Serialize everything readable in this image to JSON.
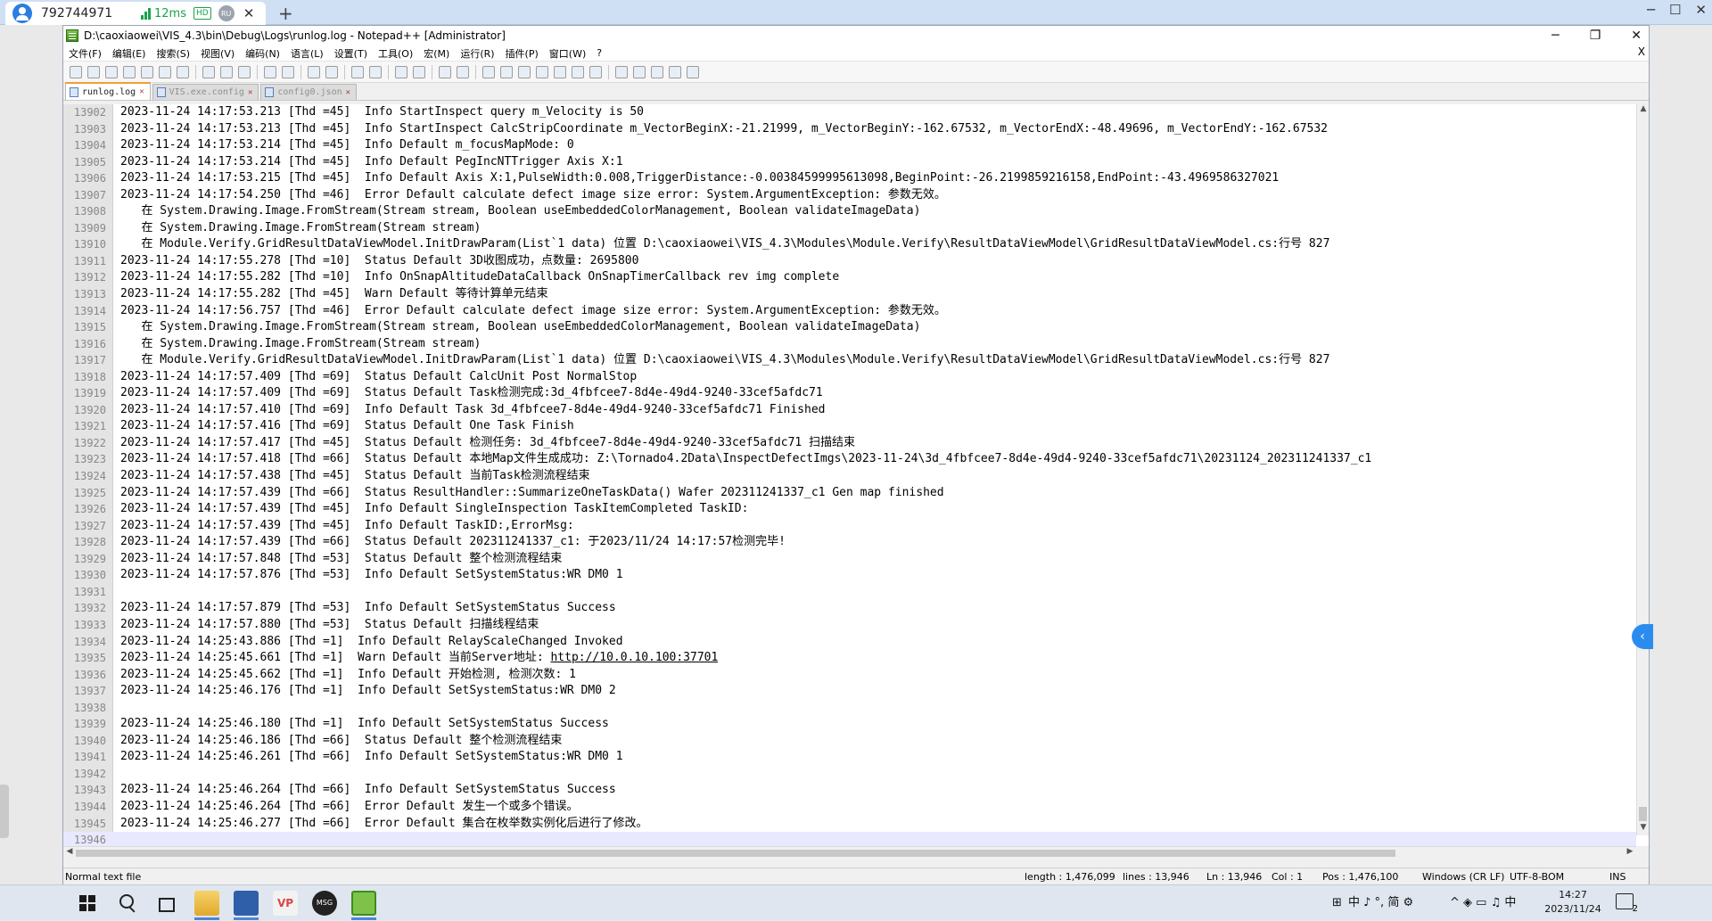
{
  "remote": {
    "session_id": "792744971",
    "ping": "12ms",
    "quality_badge": "HD",
    "region_badge": "RU",
    "close_glyph": "✕",
    "add_glyph": "+"
  },
  "window": {
    "title": "D:\\caoxiaowei\\VIS_4.3\\bin\\Debug\\Logs\\runlog.log - Notepad++ [Administrator]",
    "minimize": "─",
    "restore": "❐",
    "close": "✕"
  },
  "menu": [
    {
      "label": "文件(F)"
    },
    {
      "label": "编辑(E)"
    },
    {
      "label": "搜索(S)"
    },
    {
      "label": "视图(V)"
    },
    {
      "label": "编码(N)"
    },
    {
      "label": "语言(L)"
    },
    {
      "label": "设置(T)"
    },
    {
      "label": "工具(O)"
    },
    {
      "label": "宏(M)"
    },
    {
      "label": "运行(R)"
    },
    {
      "label": "插件(P)"
    },
    {
      "label": "窗口(W)"
    },
    {
      "label": "?"
    }
  ],
  "menu_close": "X",
  "tabs": [
    {
      "label": "runlog.log",
      "close": "✕"
    },
    {
      "label": "VIS.exe.config",
      "close": "✕"
    },
    {
      "label": "config0.json",
      "close": "✕"
    }
  ],
  "editor": {
    "lines": [
      {
        "n": "13902",
        "t": "2023-11-24 14:17:53.213 [Thd =45]  Info StartInspect query m_Velocity is 50"
      },
      {
        "n": "13903",
        "t": "2023-11-24 14:17:53.213 [Thd =45]  Info StartInspect CalcStripCoordinate m_VectorBeginX:-21.21999, m_VectorBeginY:-162.67532, m_VectorEndX:-48.49696, m_VectorEndY:-162.67532"
      },
      {
        "n": "13904",
        "t": "2023-11-24 14:17:53.214 [Thd =45]  Info Default m_focusMapMode: 0"
      },
      {
        "n": "13905",
        "t": "2023-11-24 14:17:53.214 [Thd =45]  Info Default PegIncNTTrigger Axis X:1"
      },
      {
        "n": "13906",
        "t": "2023-11-24 14:17:53.215 [Thd =45]  Info Default Axis X:1,PulseWidth:0.008,TriggerDistance:-0.00384599995613098,BeginPoint:-26.2199859216158,EndPoint:-43.4969586327021"
      },
      {
        "n": "13907",
        "t": "2023-11-24 14:17:54.250 [Thd =46]  Error Default calculate defect image size error: System.ArgumentException: 参数无效。"
      },
      {
        "n": "13908",
        "t": "   在 System.Drawing.Image.FromStream(Stream stream, Boolean useEmbeddedColorManagement, Boolean validateImageData)"
      },
      {
        "n": "13909",
        "t": "   在 System.Drawing.Image.FromStream(Stream stream)"
      },
      {
        "n": "13910",
        "t": "   在 Module.Verify.GridResultDataViewModel.InitDrawParam(List`1 data) 位置 D:\\caoxiaowei\\VIS_4.3\\Modules\\Module.Verify\\ResultDataViewModel\\GridResultDataViewModel.cs:行号 827"
      },
      {
        "n": "13911",
        "t": "2023-11-24 14:17:55.278 [Thd =10]  Status Default 3D收图成功，点数量: 2695800"
      },
      {
        "n": "13912",
        "t": "2023-11-24 14:17:55.282 [Thd =10]  Info OnSnapAltitudeDataCallback OnSnapTimerCallback rev img complete"
      },
      {
        "n": "13913",
        "t": "2023-11-24 14:17:55.282 [Thd =45]  Warn Default 等待计算单元结束"
      },
      {
        "n": "13914",
        "t": "2023-11-24 14:17:56.757 [Thd =46]  Error Default calculate defect image size error: System.ArgumentException: 参数无效。"
      },
      {
        "n": "13915",
        "t": "   在 System.Drawing.Image.FromStream(Stream stream, Boolean useEmbeddedColorManagement, Boolean validateImageData)"
      },
      {
        "n": "13916",
        "t": "   在 System.Drawing.Image.FromStream(Stream stream)"
      },
      {
        "n": "13917",
        "t": "   在 Module.Verify.GridResultDataViewModel.InitDrawParam(List`1 data) 位置 D:\\caoxiaowei\\VIS_4.3\\Modules\\Module.Verify\\ResultDataViewModel\\GridResultDataViewModel.cs:行号 827"
      },
      {
        "n": "13918",
        "t": "2023-11-24 14:17:57.409 [Thd =69]  Status Default CalcUnit Post NormalStop"
      },
      {
        "n": "13919",
        "t": "2023-11-24 14:17:57.409 [Thd =69]  Status Default Task检测完成:3d_4fbfcee7-8d4e-49d4-9240-33cef5afdc71"
      },
      {
        "n": "13920",
        "t": "2023-11-24 14:17:57.410 [Thd =69]  Info Default Task 3d_4fbfcee7-8d4e-49d4-9240-33cef5afdc71 Finished"
      },
      {
        "n": "13921",
        "t": "2023-11-24 14:17:57.416 [Thd =69]  Status Default One Task Finish"
      },
      {
        "n": "13922",
        "t": "2023-11-24 14:17:57.417 [Thd =45]  Status Default 检测任务: 3d_4fbfcee7-8d4e-49d4-9240-33cef5afdc71 扫描结束"
      },
      {
        "n": "13923",
        "t": "2023-11-24 14:17:57.418 [Thd =66]  Status Default 本地Map文件生成成功: Z:\\Tornado4.2Data\\InspectDefectImgs\\2023-11-24\\3d_4fbfcee7-8d4e-49d4-9240-33cef5afdc71\\20231124_202311241337_c1"
      },
      {
        "n": "13924",
        "t": "2023-11-24 14:17:57.438 [Thd =45]  Status Default 当前Task检测流程结束"
      },
      {
        "n": "13925",
        "t": "2023-11-24 14:17:57.439 [Thd =66]  Status ResultHandler::SummarizeOneTaskData() Wafer 202311241337_c1 Gen map finished"
      },
      {
        "n": "13926",
        "t": "2023-11-24 14:17:57.439 [Thd =45]  Info Default SingleInspection TaskItemCompleted TaskID:"
      },
      {
        "n": "13927",
        "t": "2023-11-24 14:17:57.439 [Thd =45]  Info Default TaskID:,ErrorMsg:"
      },
      {
        "n": "13928",
        "t": "2023-11-24 14:17:57.439 [Thd =66]  Status Default 202311241337_c1: 于2023/11/24 14:17:57检测完毕!"
      },
      {
        "n": "13929",
        "t": "2023-11-24 14:17:57.848 [Thd =53]  Status Default 整个检测流程结束"
      },
      {
        "n": "13930",
        "t": "2023-11-24 14:17:57.876 [Thd =53]  Info Default SetSystemStatus:WR DM0 1"
      },
      {
        "n": "13931",
        "t": ""
      },
      {
        "n": "13932",
        "t": "2023-11-24 14:17:57.879 [Thd =53]  Info Default SetSystemStatus Success"
      },
      {
        "n": "13933",
        "t": "2023-11-24 14:17:57.880 [Thd =53]  Status Default 扫描线程结束"
      },
      {
        "n": "13934",
        "t": "2023-11-24 14:25:43.886 [Thd =1]  Info Default RelayScaleChanged Invoked"
      },
      {
        "n": "13935",
        "t": "2023-11-24 14:25:45.661 [Thd =1]  Warn Default 当前Server地址: ",
        "url": "http://10.0.10.100:37701"
      },
      {
        "n": "13936",
        "t": "2023-11-24 14:25:45.662 [Thd =1]  Info Default 开始检测, 检测次数: 1"
      },
      {
        "n": "13937",
        "t": "2023-11-24 14:25:46.176 [Thd =1]  Info Default SetSystemStatus:WR DM0 2"
      },
      {
        "n": "13938",
        "t": ""
      },
      {
        "n": "13939",
        "t": "2023-11-24 14:25:46.180 [Thd =1]  Info Default SetSystemStatus Success"
      },
      {
        "n": "13940",
        "t": "2023-11-24 14:25:46.186 [Thd =66]  Status Default 整个检测流程结束"
      },
      {
        "n": "13941",
        "t": "2023-11-24 14:25:46.261 [Thd =66]  Info Default SetSystemStatus:WR DM0 1"
      },
      {
        "n": "13942",
        "t": ""
      },
      {
        "n": "13943",
        "t": "2023-11-24 14:25:46.264 [Thd =66]  Info Default SetSystemStatus Success"
      },
      {
        "n": "13944",
        "t": "2023-11-24 14:25:46.264 [Thd =66]  Error Default 发生一个或多个错误。"
      },
      {
        "n": "13945",
        "t": "2023-11-24 14:25:46.277 [Thd =66]  Error Default 集合在枚举数实例化后进行了修改。"
      },
      {
        "n": "13946",
        "t": ""
      }
    ]
  },
  "status": {
    "type": "Normal text file",
    "length": "length : 1,476,099",
    "lines": "lines : 13,946",
    "ln": "Ln : 13,946",
    "col": "Col : 1",
    "pos": "Pos : 1,476,100",
    "eol": "Windows (CR LF)",
    "encoding": "UTF-8-BOM",
    "mode": "INS"
  },
  "side_toggle": "‹",
  "taskbar": {
    "tray_text": "中 ♪ °, 简 ⚙",
    "ime_grid": "⊞",
    "tray_icons": "^ ◈ ▭ ♫ 中",
    "time": "14:27",
    "date": "2023/11/24",
    "notif_count": "2"
  }
}
